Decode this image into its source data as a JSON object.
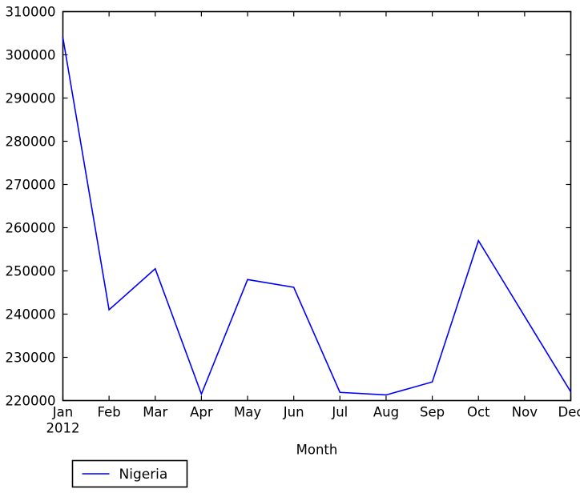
{
  "chart_data": {
    "type": "line",
    "title": "",
    "xlabel": "Month",
    "ylabel": "",
    "categories": [
      "Jan",
      "Feb",
      "Mar",
      "Apr",
      "May",
      "Jun",
      "Jul",
      "Aug",
      "Sep",
      "Oct",
      "Nov",
      "Dec"
    ],
    "x_axis_year": "2012",
    "xtick_labels": [
      "Jan",
      "Feb",
      "Mar",
      "Apr",
      "May",
      "Jun",
      "Jul",
      "Aug",
      "Sep",
      "Oct",
      "Nov",
      "Dec"
    ],
    "ytick_labels": [
      "220000",
      "230000",
      "240000",
      "250000",
      "260000",
      "270000",
      "280000",
      "290000",
      "300000",
      "310000"
    ],
    "ytick_values": [
      220000,
      230000,
      240000,
      250000,
      260000,
      270000,
      280000,
      290000,
      300000,
      310000
    ],
    "ylim": [
      220000,
      310000
    ],
    "grid": false,
    "legend_position": "below-left",
    "series": [
      {
        "name": "Nigeria",
        "color": "#0000ff",
        "values": [
          304000,
          241000,
          250500,
          221500,
          248000,
          246200,
          221900,
          221300,
          224300,
          257000,
          239500,
          222000
        ]
      }
    ]
  },
  "legend": {
    "entries": [
      {
        "label": "Nigeria",
        "color": "#0000ff"
      }
    ]
  },
  "axes": {
    "xlabel": "Month",
    "year_label": "2012"
  }
}
